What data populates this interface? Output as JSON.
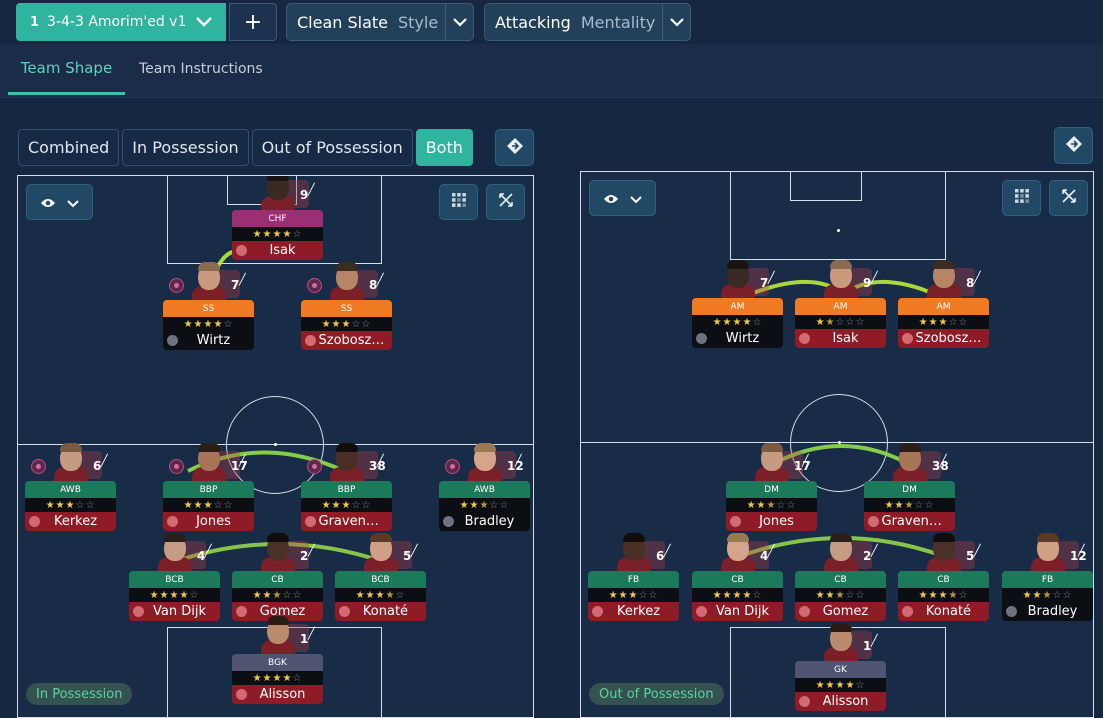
{
  "topbar": {
    "tactic_number": "1",
    "tactic_name": "3-4-3 Amorim'ed v1",
    "add_label": "+",
    "style_value": "Clean Slate",
    "style_label": "Style",
    "mentality_value": "Attacking",
    "mentality_label": "Mentality"
  },
  "tabs": [
    "Team Shape",
    "Team Instructions"
  ],
  "view_toggles": [
    "Combined",
    "In Possession",
    "Out of Possession",
    "Both"
  ],
  "active_toggle": "Both",
  "left_pitch": {
    "phase_label": "In Possession",
    "players": [
      {
        "role": "CHF",
        "name": "Isak",
        "num": "9",
        "stars": 4,
        "role_color": "#9b2f74",
        "name_color": "#8e1b26"
      },
      {
        "role": "SS",
        "name": "Wirtz",
        "num": "7",
        "stars": 4,
        "role_color": "#f07a22",
        "name_color": "#0b0f14"
      },
      {
        "role": "SS",
        "name": "Szoboszlai",
        "num": "8",
        "stars": 3,
        "role_color": "#f07a22",
        "name_color": "#8e1b26"
      },
      {
        "role": "AWB",
        "name": "Kerkez",
        "num": "6",
        "stars": 3,
        "role_color": "#1b7a5a",
        "name_color": "#8e1b26"
      },
      {
        "role": "BBP",
        "name": "Jones",
        "num": "17",
        "stars": 3,
        "role_color": "#1b7a5a",
        "name_color": "#8e1b26"
      },
      {
        "role": "BBP",
        "name": "Gravenb...",
        "num": "38",
        "stars": 3,
        "role_color": "#1b7a5a",
        "name_color": "#8e1b26"
      },
      {
        "role": "AWB",
        "name": "Bradley",
        "num": "12",
        "stars": 2.5,
        "role_color": "#1b7a5a",
        "name_color": "#0b0f14"
      },
      {
        "role": "BCB",
        "name": "Van Dijk",
        "num": "4",
        "stars": 4,
        "role_color": "#1b7a5a",
        "name_color": "#8e1b26"
      },
      {
        "role": "CB",
        "name": "Gomez",
        "num": "2",
        "stars": 2.5,
        "role_color": "#1b7a5a",
        "name_color": "#8e1b26"
      },
      {
        "role": "BCB",
        "name": "Konaté",
        "num": "5",
        "stars": 3.5,
        "role_color": "#1b7a5a",
        "name_color": "#8e1b26"
      },
      {
        "role": "BGK",
        "name": "Alisson",
        "num": "1",
        "stars": 4,
        "role_color": "#4f5470",
        "name_color": "#8e1b26"
      }
    ]
  },
  "right_pitch": {
    "phase_label": "Out of Possession",
    "players": [
      {
        "role": "AM",
        "name": "Wirtz",
        "num": "7",
        "stars": 4,
        "role_color": "#f07a22",
        "name_color": "#0b0f14"
      },
      {
        "role": "AM",
        "name": "Isak",
        "num": "9",
        "stars": 1.5,
        "role_color": "#f07a22",
        "name_color": "#8e1b26"
      },
      {
        "role": "AM",
        "name": "Szoboszlai",
        "num": "8",
        "stars": 3,
        "role_color": "#f07a22",
        "name_color": "#8e1b26"
      },
      {
        "role": "DM",
        "name": "Jones",
        "num": "17",
        "stars": 2.5,
        "role_color": "#1b7a5a",
        "name_color": "#8e1b26"
      },
      {
        "role": "DM",
        "name": "Gravenb...",
        "num": "38",
        "stars": 2.5,
        "role_color": "#1b7a5a",
        "name_color": "#8e1b26"
      },
      {
        "role": "FB",
        "name": "Kerkez",
        "num": "6",
        "stars": 3,
        "role_color": "#1b7a5a",
        "name_color": "#8e1b26"
      },
      {
        "role": "CB",
        "name": "Van Dijk",
        "num": "4",
        "stars": 4,
        "role_color": "#1b7a5a",
        "name_color": "#8e1b26"
      },
      {
        "role": "CB",
        "name": "Gomez",
        "num": "2",
        "stars": 2.5,
        "role_color": "#1b7a5a",
        "name_color": "#8e1b26"
      },
      {
        "role": "CB",
        "name": "Konaté",
        "num": "5",
        "stars": 3.5,
        "role_color": "#1b7a5a",
        "name_color": "#8e1b26"
      },
      {
        "role": "FB",
        "name": "Bradley",
        "num": "12",
        "stars": 2.5,
        "role_color": "#1b7a5a",
        "name_color": "#0b0f14"
      },
      {
        "role": "GK",
        "name": "Alisson",
        "num": "1",
        "stars": 4,
        "role_color": "#4f5470",
        "name_color": "#8e1b26"
      }
    ]
  },
  "icons": {
    "dropdown": "chevron-down-icon",
    "visibility": "eye-icon",
    "grid": "grid-icon",
    "expand": "expand-icon",
    "options": "diamond-arrows-icon"
  },
  "colors": {
    "accent": "#2fb4a0",
    "background": "#162741",
    "link_line": "#a8e63a"
  }
}
